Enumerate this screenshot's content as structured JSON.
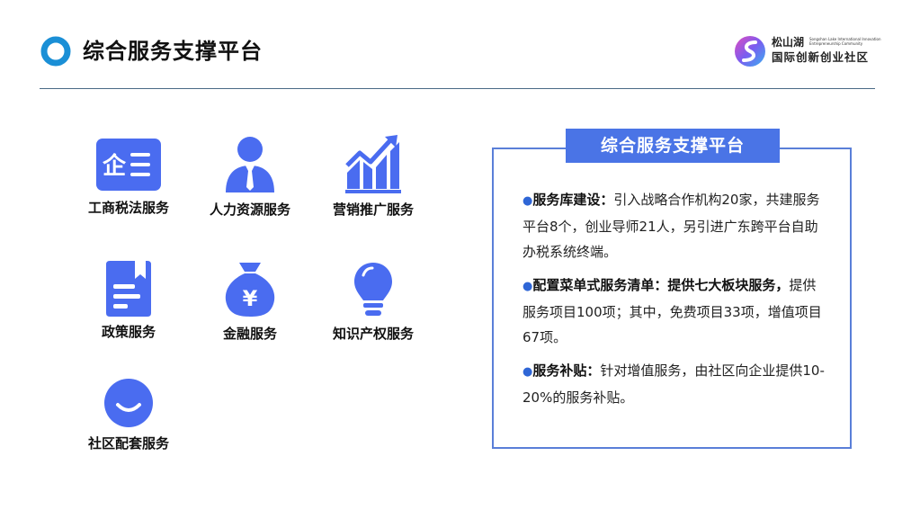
{
  "header": {
    "title": "综合服务支撑平台"
  },
  "logo": {
    "name_cn": "松山湖",
    "name_en": "Songshan Lake International Innovation Entrepreneurship Community",
    "subtitle": "国际创新创业社区"
  },
  "services": [
    {
      "label": "工商税法服务",
      "icon": "enterprise-icon"
    },
    {
      "label": "人力资源服务",
      "icon": "person-icon"
    },
    {
      "label": "营销推广服务",
      "icon": "growth-chart-icon"
    },
    {
      "label": "政策服务",
      "icon": "document-icon"
    },
    {
      "label": "金融服务",
      "icon": "money-bag-icon"
    },
    {
      "label": "知识产权服务",
      "icon": "lightbulb-icon"
    },
    {
      "label": "社区配套服务",
      "icon": "smile-icon"
    }
  ],
  "panel": {
    "title": "综合服务支撑平台",
    "items": [
      {
        "heading": "服务库建设：",
        "text": "引入战略合作机构20家，共建服务平台8个，创业导师21人，另引进广东跨平台自助办税系统终端。"
      },
      {
        "heading": "配置菜单式服务清单：提供七大板块服务，",
        "text": "提供服务项目100项；其中，免费项目33项，增值项目67项。"
      },
      {
        "heading": "服务补贴：",
        "text": "针对增值服务，由社区向企业提供10-20%的服务补贴。"
      }
    ]
  },
  "colors": {
    "accent": "#4a74e6",
    "icon": "#4a6cf0",
    "title_ring": "#1a8fd6"
  }
}
